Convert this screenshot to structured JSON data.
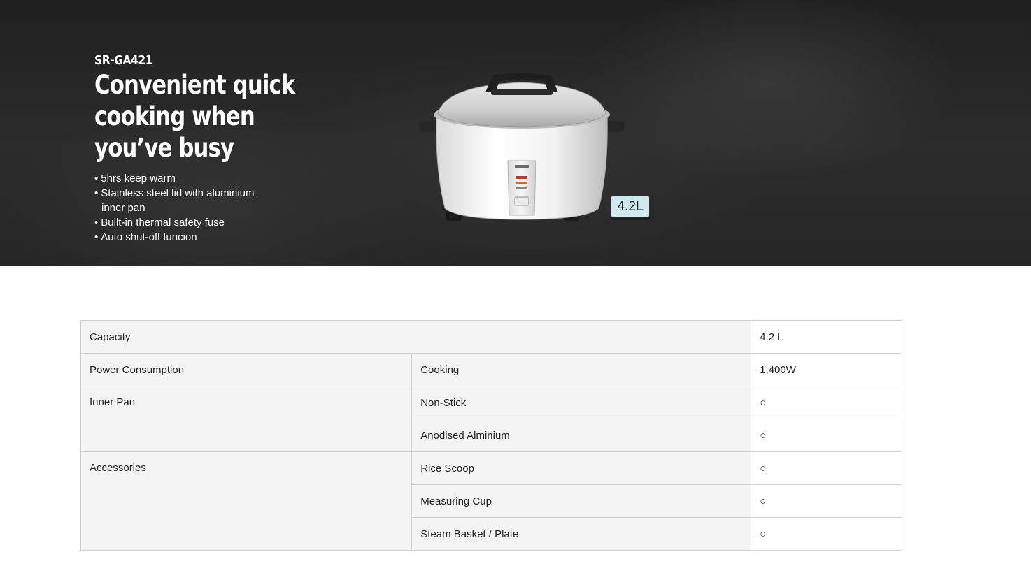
{
  "hero": {
    "model": "SR-GA421",
    "headline_lines": [
      "Convenient quick",
      "cooking when",
      "you’ve busy"
    ],
    "features": [
      "5hrs keep warm",
      "Stainless steel lid with aluminium inner pan",
      "Built-in thermal safety fuse",
      "Auto shut-off funcion"
    ],
    "capacity_badge": "4.2L"
  },
  "specs": {
    "capacity": {
      "label": "Capacity",
      "value": "4.2 L"
    },
    "power": {
      "label": "Power Consumption",
      "sub": "Cooking",
      "value": "1,400W"
    },
    "inner_pan": {
      "label": "Inner Pan",
      "rows": [
        {
          "sub": "Non-Stick",
          "value": "○"
        },
        {
          "sub": "Anodised Alminium",
          "value": "○"
        }
      ]
    },
    "accessories": {
      "label": "Accessories",
      "rows": [
        {
          "sub": "Rice Scoop",
          "value": "○"
        },
        {
          "sub": "Measuring Cup",
          "value": "○"
        },
        {
          "sub": "Steam Basket / Plate",
          "value": "○"
        }
      ]
    }
  },
  "colors": {
    "hero_background": "#262626",
    "badge_background": "#cfe9ee",
    "label_cell_background": "#f4f4f4",
    "border": "#cfcfcf"
  }
}
